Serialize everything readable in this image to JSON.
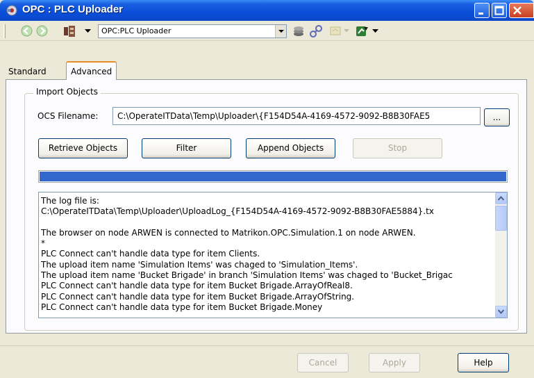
{
  "window": {
    "title": "OPC : PLC Uploader"
  },
  "toolbar": {
    "address": "OPC:PLC Uploader"
  },
  "tabs": [
    {
      "label": "Standard"
    },
    {
      "label": "Advanced"
    }
  ],
  "import_group": {
    "legend": "Import Objects",
    "ocs_label": "OCS Filename:",
    "ocs_value": "C:\\OperateITData\\Temp\\Uploader\\{F154D54A-4169-4572-9092-B8B30FAE5",
    "browse_label": "..."
  },
  "actions": {
    "retrieve": "Retrieve Objects",
    "filter": "Filter",
    "append": "Append Objects",
    "stop": "Stop"
  },
  "progress": {
    "percent": 100
  },
  "log": {
    "lines": [
      "The log file is:",
      "C:\\OperateITData\\Temp\\Uploader\\UploadLog_{F154D54A-4169-4572-9092-B8B30FAE5884}.tx",
      "",
      "The browser on node ARWEN is connected to Matrikon.OPC.Simulation.1 on node ARWEN.",
      "*",
      "PLC Connect can't handle data type for item Clients.",
      "The upload item name 'Simulation Items' was chaged to 'Simulation_Items'.",
      "The upload item name 'Bucket Brigade' in branch 'Simulation Items' was chaged to 'Bucket_Brigac",
      "PLC Connect can't handle data type for item Bucket Brigade.ArrayOfReal8.",
      "PLC Connect can't handle data type for item Bucket Brigade.ArrayOfString.",
      "PLC Connect can't handle data type for item Bucket Brigade.Money"
    ]
  },
  "footer": {
    "cancel": "Cancel",
    "apply": "Apply",
    "help": "Help"
  }
}
